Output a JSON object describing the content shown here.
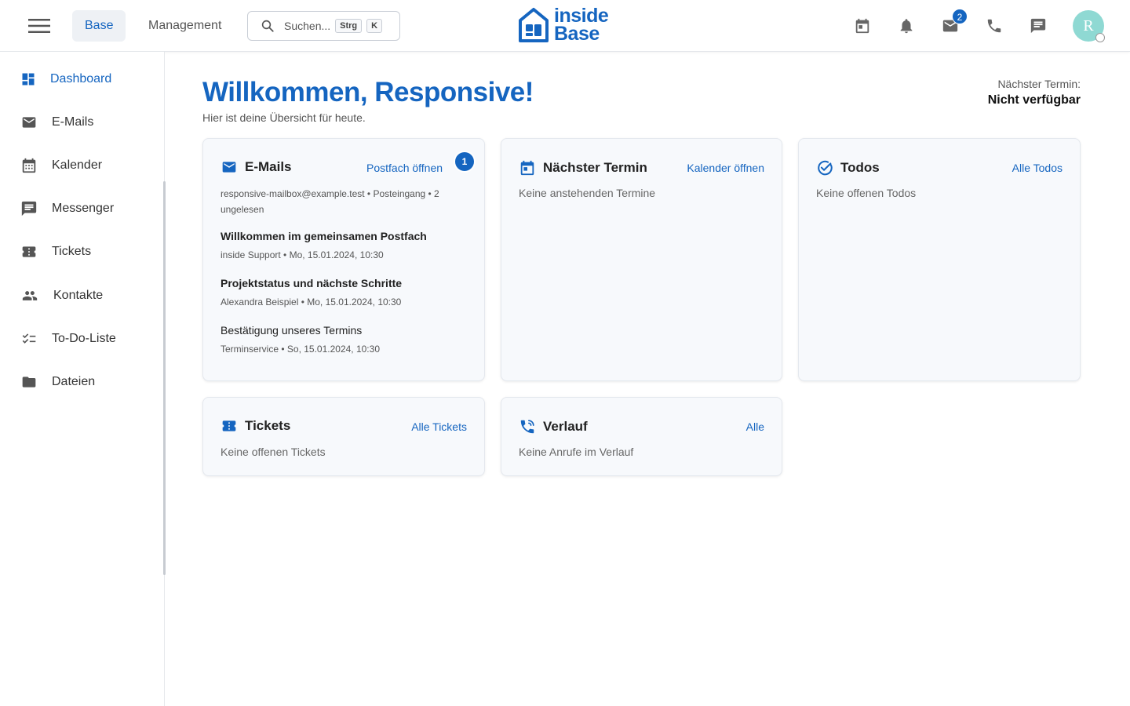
{
  "header": {
    "tabs": [
      {
        "label": "Base",
        "active": true
      },
      {
        "label": "Management",
        "active": false
      }
    ],
    "search": {
      "placeholder": "Suchen...",
      "shortcut_mod": "Strg",
      "shortcut_key": "K"
    },
    "logo": {
      "line1": "inside",
      "line2": "Base"
    },
    "mail_badge": "2",
    "avatar_initial": "R",
    "icons": [
      "calendar-icon",
      "bell-icon",
      "mail-icon",
      "phone-icon",
      "chat-icon"
    ]
  },
  "sidebar": {
    "items": [
      {
        "label": "Dashboard",
        "icon": "dashboard-icon",
        "active": true
      },
      {
        "label": "E-Mails",
        "icon": "mail-icon"
      },
      {
        "label": "Kalender",
        "icon": "calendar-icon"
      },
      {
        "label": "Messenger",
        "icon": "chat-icon"
      },
      {
        "label": "Tickets",
        "icon": "ticket-icon"
      },
      {
        "label": "Kontakte",
        "icon": "contacts-icon"
      },
      {
        "label": "To-Do-Liste",
        "icon": "checklist-icon"
      },
      {
        "label": "Dateien",
        "icon": "folder-icon"
      }
    ]
  },
  "main": {
    "welcome": "Willkommen, Responsive!",
    "subtitle": "Hier ist deine Übersicht für heute.",
    "next_appointment_label": "Nächster Termin:",
    "next_appointment_value": "Nicht verfügbar"
  },
  "cards": {
    "emails": {
      "title": "E-Mails",
      "link": "Postfach öffnen",
      "badge": "1",
      "meta": "responsive-mailbox@example.test • Posteingang • 2 ungelesen",
      "items": [
        {
          "subject": "Willkommen im gemeinsamen Postfach",
          "from": "inside Support • Mo, 15.01.2024, 10:30",
          "unread": true
        },
        {
          "subject": "Projektstatus und nächste Schritte",
          "from": "Alexandra Beispiel • Mo, 15.01.2024, 10:30",
          "unread": true
        },
        {
          "subject": "Bestätigung unseres Termins",
          "from": "Terminservice • So, 15.01.2024, 10:30",
          "unread": false
        }
      ]
    },
    "appointment": {
      "title": "Nächster Termin",
      "link": "Kalender öffnen",
      "empty": "Keine anstehenden Termine"
    },
    "todos": {
      "title": "Todos",
      "link": "Alle Todos",
      "empty": "Keine offenen Todos"
    },
    "tickets": {
      "title": "Tickets",
      "link": "Alle Tickets",
      "empty": "Keine offenen Tickets"
    },
    "history": {
      "title": "Verlauf",
      "link": "Alle",
      "empty": "Keine Anrufe im Verlauf"
    }
  },
  "colors": {
    "accent": "#1565c0",
    "avatar": "#8fd9d3",
    "card_bg": "#f7f9fc"
  }
}
